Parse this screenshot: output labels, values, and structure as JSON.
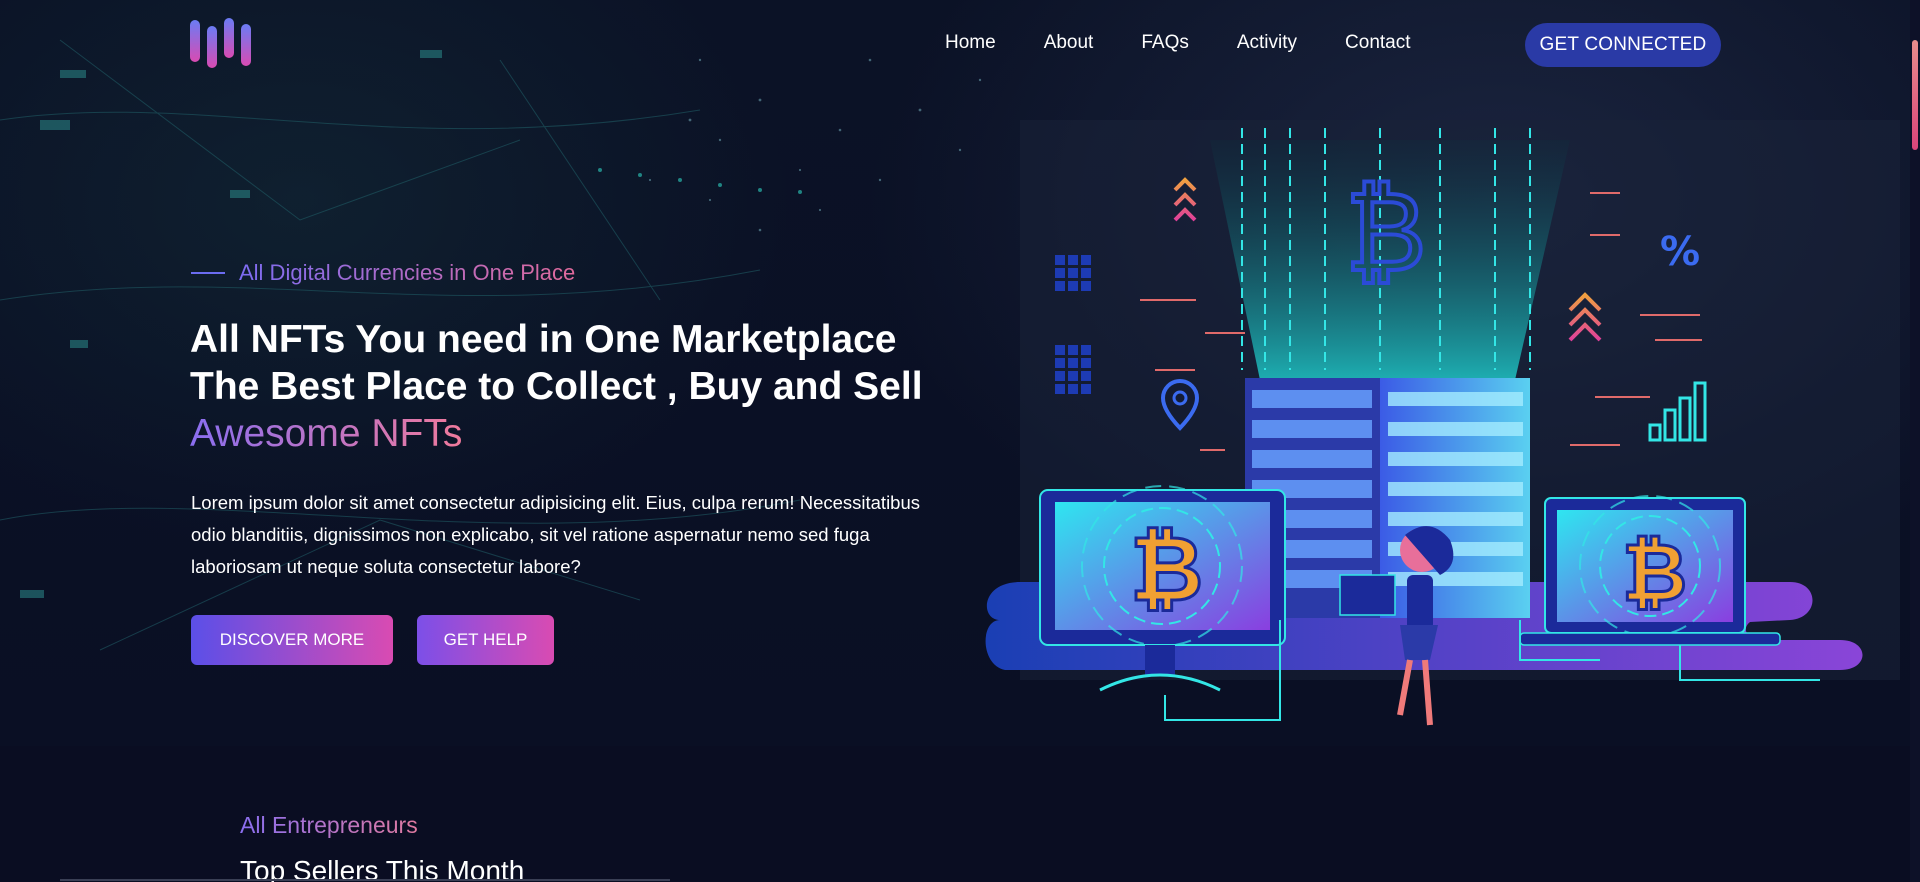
{
  "nav": {
    "items": [
      "Home",
      "About",
      "FAQs",
      "Activity",
      "Contact"
    ],
    "cta": "GET CONNECTED"
  },
  "hero": {
    "tagline": "All Digital Currencies in One Place",
    "headline_main": "All NFTs You need in One Marketplace The Best Place to Collect , Buy and Sell ",
    "headline_accent": "Awesome NFTs",
    "description": "Lorem ipsum dolor sit amet consectetur adipisicing elit. Eius, culpa rerum! Necessitatibus odio blanditiis, dignissimos non explicabo, sit vel ratione aspernatur nemo sed fuga laboriosam ut neque soluta consectetur labore?",
    "primary_button": "DISCOVER MORE",
    "secondary_button": "GET HELP"
  },
  "section": {
    "subtitle": "All Entrepreneurs",
    "title": "Top Sellers This Month"
  },
  "illustration": {
    "percent_symbol": "%"
  },
  "colors": {
    "background": "#0a0d22",
    "accent_blue": "#2a3aa6",
    "gradient_start": "#5b4fe8",
    "gradient_end": "#d94bb2",
    "cyan": "#2ee6e6"
  }
}
